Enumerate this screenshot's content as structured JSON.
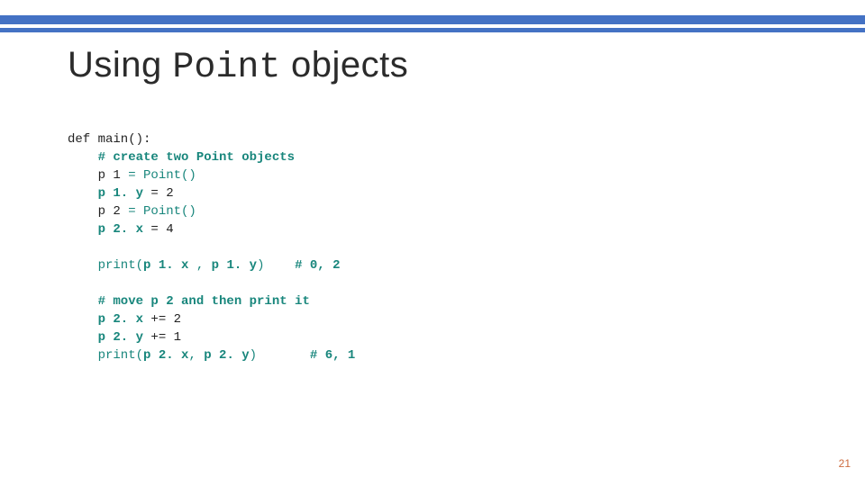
{
  "title": {
    "pre": "Using ",
    "mono": "Point",
    "post": " objects"
  },
  "code": {
    "l1": "def main():",
    "l2": "    # create two Point objects",
    "l3a": "    p 1 ",
    "l3b": "= Point()",
    "l4a": "    p 1. y ",
    "l4b": "= 2",
    "l5a": "    p 2 ",
    "l5b": "= Point()",
    "l6a": "    p 2. x ",
    "l6b": "= 4",
    "l7a": "    print(",
    "l7b": "p 1. x ",
    "l7c": ", ",
    "l7d": "p 1. y",
    "l7e": ")    ",
    "l7f": "# 0, 2",
    "l8": "    # move p 2 and then print it",
    "l9a": "    p 2. x ",
    "l9b": "+= 2",
    "l10a": "    p 2. y ",
    "l10b": "+= 1",
    "l11a": "    print(",
    "l11b": "p 2. x",
    "l11c": ", ",
    "l11d": "p 2. y",
    "l11e": ")       ",
    "l11f": "# 6, 1"
  },
  "page_number": "21"
}
